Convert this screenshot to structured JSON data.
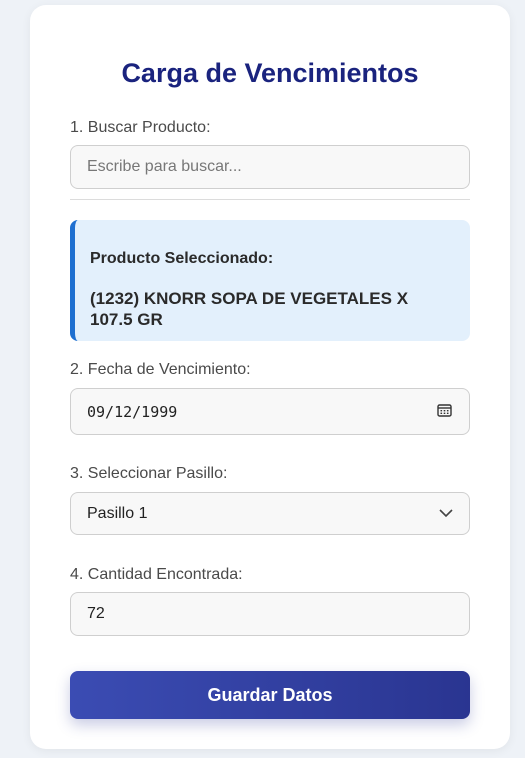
{
  "title": "Carga de Vencimientos",
  "search": {
    "label": "1. Buscar Producto:",
    "placeholder": "Escribe para buscar..."
  },
  "selected": {
    "heading": "Producto Seleccionado:",
    "product": "(1232) KNORR SOPA DE VEGETALES X 107.5 GR"
  },
  "expiry": {
    "label": "2. Fecha de Vencimiento:",
    "value": "09/12/1999"
  },
  "aisle": {
    "label": "3. Seleccionar Pasillo:",
    "value": "Pasillo 1"
  },
  "quantity": {
    "label": "4. Cantidad Encontrada:",
    "value": "72"
  },
  "save_label": "Guardar Datos",
  "colors": {
    "title": "#1a237e",
    "accent": "#1e6fd0",
    "selected_bg": "#e3f0fc",
    "button_start": "#3b4cb3",
    "button_end": "#2a3591"
  }
}
